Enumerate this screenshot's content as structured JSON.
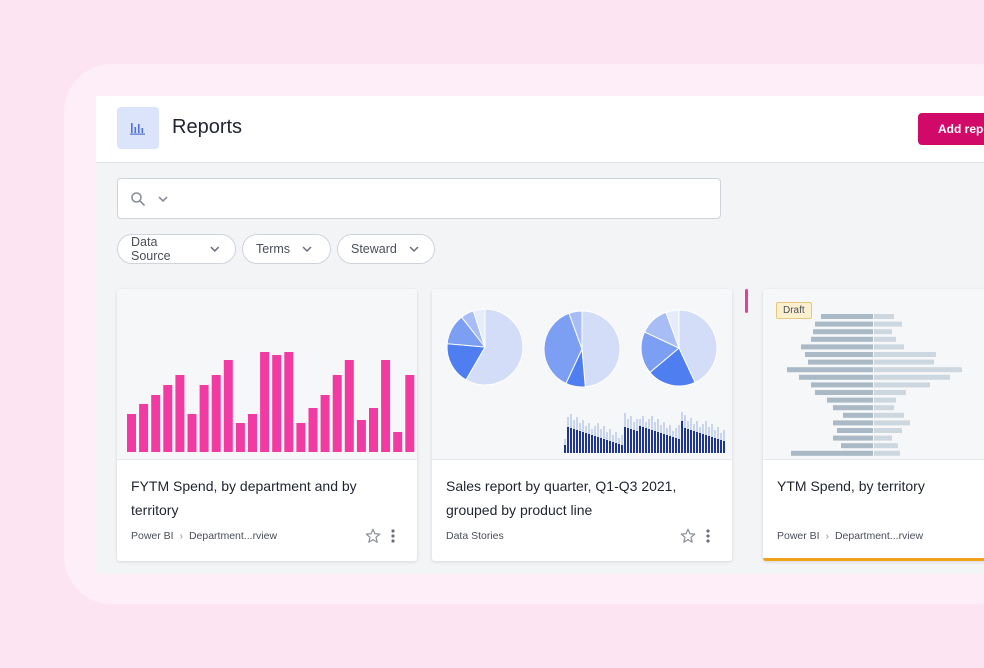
{
  "header": {
    "title": "Reports",
    "add_button_label": "Add repo"
  },
  "search": {
    "placeholder": ""
  },
  "filters": [
    {
      "label": "Data Source"
    },
    {
      "label": "Terms"
    },
    {
      "label": "Steward"
    }
  ],
  "colors": {
    "accent": "#d10a6a",
    "bar_pink": "#f23aa3",
    "pie_blue": "#4f7ef0",
    "navy": "#1f3590",
    "slate": "#b1c0cc",
    "draft_underline": "#f0a21b"
  },
  "cards": [
    {
      "title": "FYTM Spend, by department and by territory",
      "source": "Power BI",
      "path": "Department...rview",
      "thumbnail_icon": "bar-chart-thumbnail"
    },
    {
      "title": "Sales report by quarter, Q1-Q3 2021, grouped by product line",
      "source": "Data Stories",
      "path": "",
      "thumbnail_icon": "pie-charts-thumbnail"
    },
    {
      "title": "YTM Spend, by territory",
      "source": "Power BI",
      "path": "Department...rview",
      "badge": "Draft",
      "thumbnail_icon": "diverging-bars-thumbnail"
    }
  ]
}
